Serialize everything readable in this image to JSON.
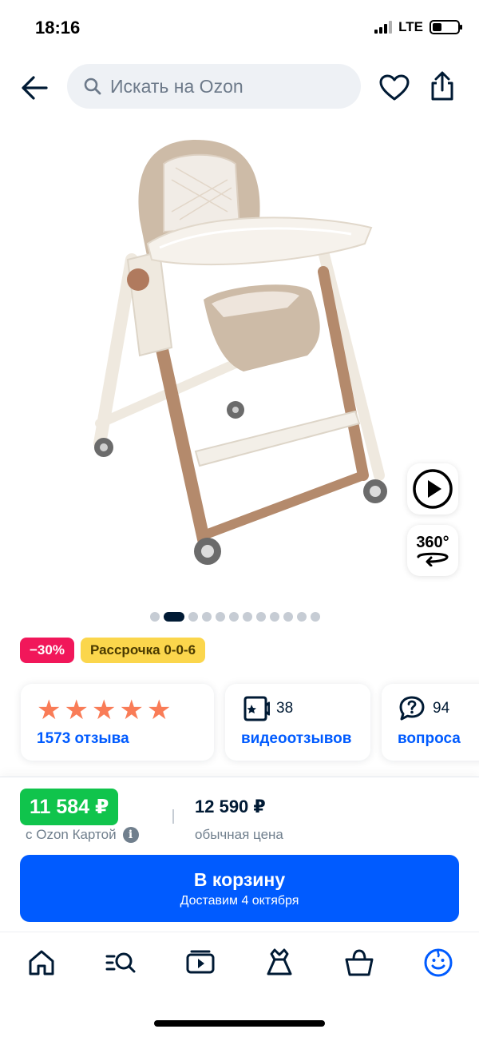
{
  "status_bar": {
    "time": "18:16",
    "network": "LTE",
    "battery_level": 0.35
  },
  "header": {
    "search_placeholder": "Искать на Ozon",
    "icons": [
      "back-arrow-icon",
      "search-icon",
      "heart-icon",
      "share-icon"
    ]
  },
  "gallery": {
    "total_images": 12,
    "active_index": 1,
    "video_icon": "play-icon",
    "tour_label": "360°"
  },
  "badges": {
    "discount": "−30%",
    "installment": "Рассрочка 0-0-6"
  },
  "rating": {
    "stars": 5,
    "reviews_label": "1573 отзыва"
  },
  "video_reviews": {
    "count": "38",
    "label": "видеоотзывов"
  },
  "questions": {
    "count": "94",
    "label": "вопроса"
  },
  "prices": {
    "card_price": "11 584 ₽",
    "card_price_label": "с Ozon Картой",
    "regular_price": "12 590 ₽",
    "regular_price_label": "обычная цена"
  },
  "cart_button": {
    "title": "В корзину",
    "subtitle": "Доставим 4 октября"
  },
  "tab_bar": {
    "items": [
      "home-icon",
      "catalog-search-icon",
      "video-icon",
      "fashion-icon",
      "cart-icon",
      "profile-icon"
    ],
    "active": "profile-icon"
  },
  "colors": {
    "brand_blue": "#005bff",
    "discount_pink": "#f1175a",
    "installment_yellow": "#fbd64c",
    "price_green": "#10c44c",
    "star_orange": "#f97c57",
    "text_dark": "#001a34"
  }
}
